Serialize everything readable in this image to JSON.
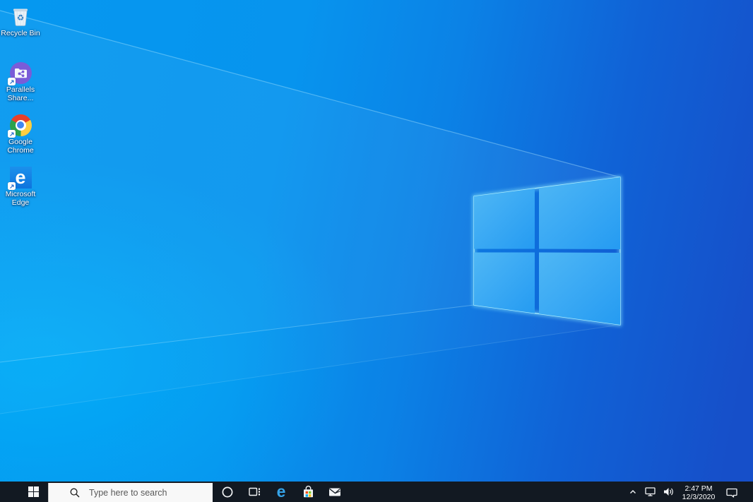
{
  "wallpaper": {
    "name": "windows-10-light-default",
    "colors": {
      "bright_left": "#00aaf8",
      "mid_blue": "#0b82e6",
      "deep_right": "#164fc9",
      "logo_pane_light": "#4fb7f5",
      "logo_pane_dark": "#259bf2",
      "logo_glow": "#8aeafc"
    }
  },
  "glyphs": {
    "edge_e": "e",
    "recycle": "♻"
  },
  "desktop": {
    "icons": [
      {
        "name": "recycle-bin",
        "lines": [
          "Recycle Bin"
        ],
        "shortcut": false
      },
      {
        "name": "parallels-shared-folders",
        "lines": [
          "Parallels",
          "Share..."
        ],
        "shortcut": true
      },
      {
        "name": "google-chrome",
        "lines": [
          "Google",
          "Chrome"
        ],
        "shortcut": true
      },
      {
        "name": "microsoft-edge",
        "lines": [
          "Microsoft",
          "Edge"
        ],
        "shortcut": true
      }
    ]
  },
  "taskbar": {
    "start": {
      "icon": "windows-start-icon"
    },
    "search": {
      "placeholder": "Type here to search",
      "icon": "search-icon"
    },
    "app_buttons": [
      {
        "name": "cortana",
        "icon": "cortana-circle-icon"
      },
      {
        "name": "task-view",
        "icon": "task-view-icon"
      },
      {
        "name": "microsoft-edge",
        "icon": "edge-e-icon"
      },
      {
        "name": "microsoft-store",
        "icon": "store-bag-icon"
      },
      {
        "name": "mail",
        "icon": "mail-envelope-icon"
      }
    ],
    "tray": {
      "icons": [
        "hidden-icons-chevron",
        "network",
        "volume",
        "action-center"
      ],
      "time": "2:47 PM",
      "date": "12/3/2020"
    }
  }
}
